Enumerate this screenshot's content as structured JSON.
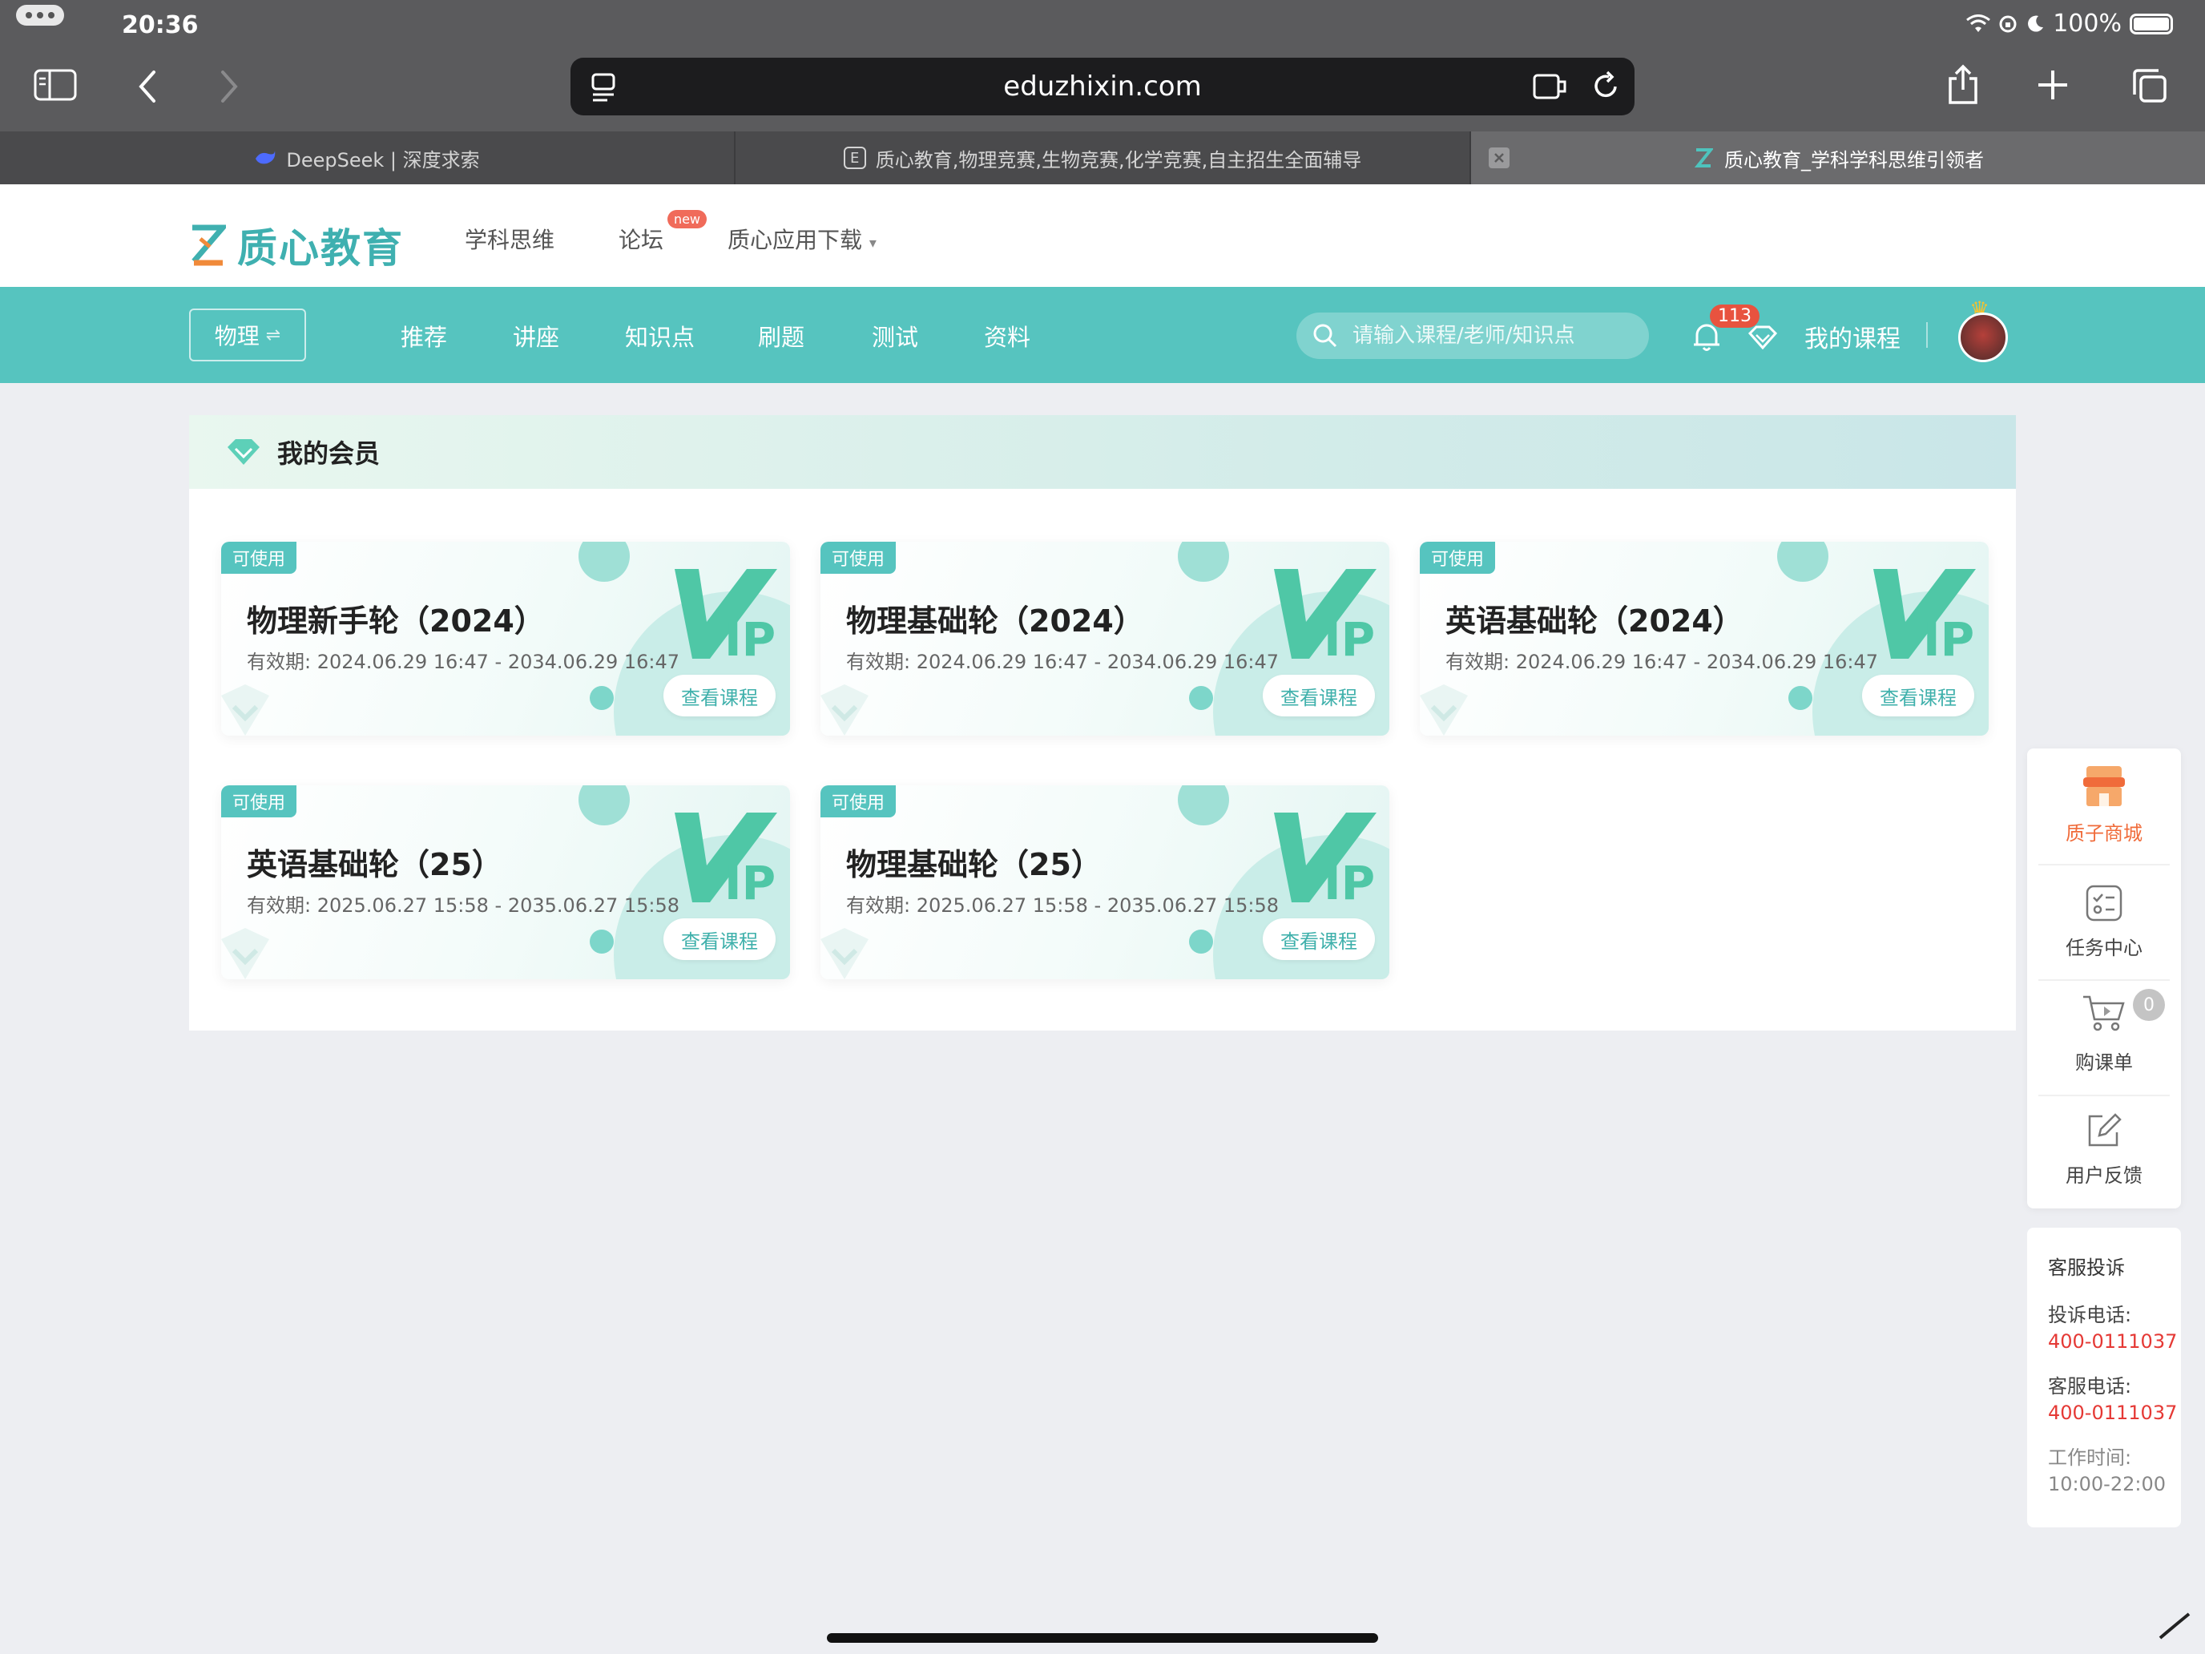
{
  "status": {
    "time": "20:36",
    "battery": "100%"
  },
  "browser": {
    "url": "eduzhixin.com",
    "tabs": [
      {
        "label": "DeepSeek | 深度求索"
      },
      {
        "label": "质心教育,物理竞赛,生物竞赛,化学竞赛,自主招生全面辅导",
        "favicon": "E"
      },
      {
        "label": "质心教育_学科学科思维引领者"
      }
    ]
  },
  "site": {
    "logo": "质心教育",
    "topnav": [
      "学科思维",
      "论坛",
      "质心应用下载"
    ],
    "new_badge": "new"
  },
  "nav": {
    "subject": "物理",
    "items": [
      "推荐",
      "讲座",
      "知识点",
      "刷题",
      "测试",
      "资料"
    ],
    "search_placeholder": "请输入课程/老师/知识点",
    "notifications": "113",
    "my_courses": "我的课程"
  },
  "panel": {
    "title": "我的会员",
    "cards": [
      {
        "tag": "可使用",
        "title": "物理新手轮（2024）",
        "date": "有效期: 2024.06.29 16:47 - 2034.06.29 16:47",
        "button": "查看课程"
      },
      {
        "tag": "可使用",
        "title": "物理基础轮（2024）",
        "date": "有效期: 2024.06.29 16:47 - 2034.06.29 16:47",
        "button": "查看课程"
      },
      {
        "tag": "可使用",
        "title": "英语基础轮（2024）",
        "date": "有效期: 2024.06.29 16:47 - 2034.06.29 16:47",
        "button": "查看课程"
      },
      {
        "tag": "可使用",
        "title": "英语基础轮（25）",
        "date": "有效期: 2025.06.27 15:58 - 2035.06.27 15:58",
        "button": "查看课程"
      },
      {
        "tag": "可使用",
        "title": "物理基础轮（25）",
        "date": "有效期: 2025.06.27 15:58 - 2035.06.27 15:58",
        "button": "查看课程"
      }
    ]
  },
  "float": {
    "shop": "质子商城",
    "tasks": "任务中心",
    "cart": "购课单",
    "cart_count": "0",
    "feedback": "用户反馈"
  },
  "service": {
    "title": "客服投诉",
    "complaint_label": "投诉电话:",
    "complaint_phone": "400-0111037",
    "service_label": "客服电话:",
    "service_phone": "400-0111037",
    "hours_label": "工作时间:",
    "hours": "10:00-22:00"
  },
  "colors": {
    "accent": "#56c4bf",
    "shop": "#f06b3a",
    "phone": "#e53935"
  }
}
